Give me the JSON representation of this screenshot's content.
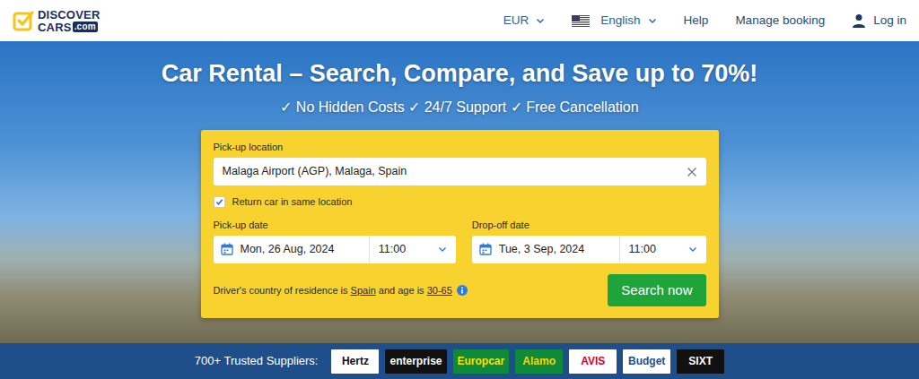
{
  "navbar": {
    "logo": {
      "line1": "DISCOVER",
      "line2": "CARS",
      "suffix": ".com"
    },
    "currency": "EUR",
    "language": "English",
    "links": [
      "Help",
      "Manage booking"
    ],
    "login": "Log in"
  },
  "hero": {
    "title": "Car Rental – Search, Compare, and Save up to 70%!",
    "subtitle": "✓ No Hidden Costs ✓ 24/7 Support ✓ Free Cancellation"
  },
  "search": {
    "pickup_label": "Pick-up location",
    "pickup_value": "Malaga Airport (AGP), Malaga, Spain",
    "same_location": {
      "label": "Return car in same location",
      "checked": true
    },
    "pickup_date": {
      "label": "Pick-up date",
      "date": "Mon, 26 Aug, 2024",
      "time": "11:00"
    },
    "dropoff_date": {
      "label": "Drop-off date",
      "date": "Tue, 3 Sep, 2024",
      "time": "11:00"
    },
    "residence": {
      "prefix": "Driver's country of residence is",
      "country": "Spain",
      "middle": "and age is",
      "age": "30-65"
    },
    "button": "Search now"
  },
  "suppliers": {
    "label": "700+ Trusted Suppliers:",
    "logos": [
      {
        "name": "Hertz",
        "kind": "white",
        "color": "#111111"
      },
      {
        "name": "enterprise",
        "kind": "black",
        "color": "#ffffff"
      },
      {
        "name": "Europcar",
        "kind": "green",
        "color": "#ffe000"
      },
      {
        "name": "Alamo",
        "kind": "green",
        "color": "#ffd200"
      },
      {
        "name": "AVIS",
        "kind": "white",
        "color": "#d4002a"
      },
      {
        "name": "Budget",
        "kind": "white",
        "color": "#1f4e8c"
      },
      {
        "name": "SIXT",
        "kind": "black",
        "color": "#ffffff"
      }
    ]
  }
}
